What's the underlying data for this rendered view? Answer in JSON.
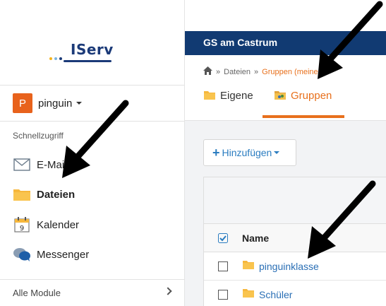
{
  "app": {
    "logo_text": "IServ",
    "logo_dot_colors": [
      "#f3b31b",
      "#7bb4e0",
      "#1b3a78"
    ]
  },
  "sidebar": {
    "user_initial": "P",
    "user_name": "pinguin",
    "quick_access_label": "Schnellzugriff",
    "items": [
      {
        "label": "E-Mail",
        "icon": "envelope-icon"
      },
      {
        "label": "Dateien",
        "icon": "folder-icon",
        "active": true
      },
      {
        "label": "Kalender",
        "icon": "calendar-icon",
        "icon_text": "9"
      },
      {
        "label": "Messenger",
        "icon": "chat-bubbles-icon"
      }
    ],
    "all_modules_label": "Alle Module"
  },
  "main": {
    "topbar_title": "GS am Castrum",
    "breadcrumb": {
      "home_icon": "home-icon",
      "separator": "»",
      "items": [
        "Dateien",
        "Gruppen (meinen)"
      ]
    },
    "tabs": [
      {
        "label": "Eigene",
        "icon": "folder-icon"
      },
      {
        "label": "Gruppen",
        "icon": "group-folder-icon",
        "active": true
      }
    ],
    "add_button_label": "Hinzufügen",
    "table": {
      "header_name": "Name",
      "rows": [
        {
          "name": "pinguinklasse",
          "icon": "folder-icon"
        },
        {
          "name": "Schüler",
          "icon": "folder-icon"
        }
      ]
    }
  },
  "colors": {
    "brand_navy": "#113a72",
    "accent_orange": "#e8701c",
    "link_blue": "#2a6fb5",
    "avatar_orange": "#e8621c",
    "folder_yellow": "#f6b73c"
  },
  "annotation_arrows": [
    "arrow-to-gruppen-tab",
    "arrow-to-dateien",
    "arrow-to-pinguinklasse"
  ]
}
